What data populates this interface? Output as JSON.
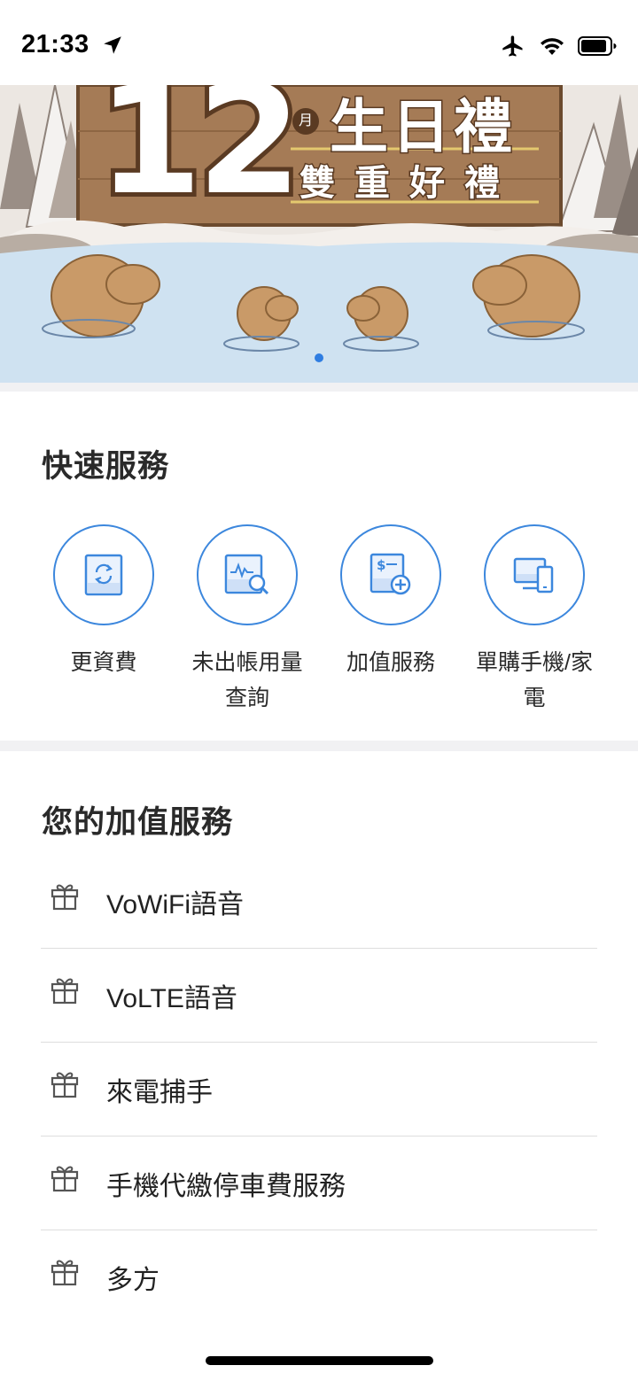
{
  "status_bar": {
    "time": "21:33"
  },
  "banner": {
    "big_number": "12",
    "month_char": "月",
    "title": "生日禮",
    "subtitle": "雙重好禮"
  },
  "quick_services": {
    "title": "快速服務",
    "items": [
      {
        "label": "更資費",
        "icon": "plan-change-icon"
      },
      {
        "label": "未出帳用量\n查詢",
        "icon": "usage-search-icon"
      },
      {
        "label": "加值服務",
        "icon": "add-service-icon"
      },
      {
        "label": "單購手機/家\n電",
        "icon": "device-purchase-icon"
      }
    ]
  },
  "value_added_services": {
    "title": "您的加值服務",
    "items": [
      {
        "label": "VoWiFi語音",
        "icon": "gift-icon"
      },
      {
        "label": "VoLTE語音",
        "icon": "gift-icon"
      },
      {
        "label": "來電捕手",
        "icon": "gift-icon"
      },
      {
        "label": "手機代繳停車費服務",
        "icon": "gift-icon"
      },
      {
        "label": "多方",
        "icon": "gift-icon"
      }
    ]
  },
  "colors": {
    "accent": "#3c87dd",
    "text": "#222222",
    "divider": "#f1f1f3"
  }
}
